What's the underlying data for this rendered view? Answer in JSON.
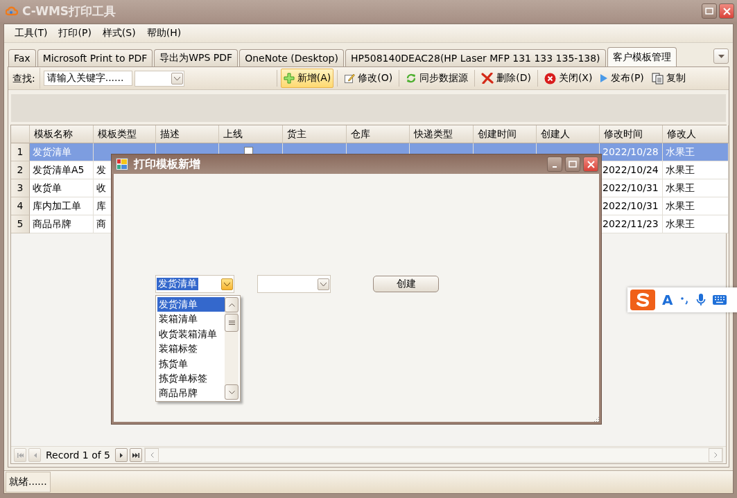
{
  "window": {
    "title": "C-WMS打印工具"
  },
  "menu": [
    "工具(T)",
    "打印(P)",
    "样式(S)",
    "帮助(H)"
  ],
  "tabs": [
    {
      "label": "Fax",
      "selected": false
    },
    {
      "label": "Microsoft Print to PDF",
      "selected": false
    },
    {
      "label": "导出为WPS PDF",
      "selected": false
    },
    {
      "label": "OneNote (Desktop)",
      "selected": false
    },
    {
      "label": "HP508140DEAC28(HP Laser MFP 131 133 135-138)",
      "selected": false
    },
    {
      "label": "客户模板管理",
      "selected": true
    }
  ],
  "toolbar": {
    "search_label": "查找:",
    "search_value": "请输入关键字......",
    "buttons": [
      {
        "kind": "add",
        "label": "新增(A)",
        "selected": true
      },
      {
        "kind": "edit",
        "label": "修改(O)",
        "selected": false
      },
      {
        "kind": "sync",
        "label": "同步数据源",
        "selected": false
      },
      {
        "kind": "delete",
        "label": "删除(D)",
        "selected": false
      },
      {
        "kind": "close",
        "label": "关闭(X)",
        "selected": false
      },
      {
        "kind": "publish",
        "label": "发布(P)",
        "selected": false
      },
      {
        "kind": "copy",
        "label": "复制",
        "selected": false
      }
    ]
  },
  "table": {
    "columns": [
      "模板名称",
      "模板类型",
      "描述",
      "上线",
      "货主",
      "仓库",
      "快递类型",
      "创建时间",
      "创建人",
      "修改时间",
      "修改人"
    ],
    "rows": [
      {
        "number": "1",
        "selected": true,
        "online": false,
        "cells": [
          "发货清单",
          null,
          null,
          null,
          null,
          null,
          null,
          null,
          null,
          "2022/10/28",
          "水果王"
        ]
      },
      {
        "number": "2",
        "selected": false,
        "cells": [
          "发货清单A5",
          "发",
          null,
          null,
          null,
          null,
          null,
          null,
          null,
          "2022/10/24",
          "水果王"
        ]
      },
      {
        "number": "3",
        "selected": false,
        "cells": [
          "收货单",
          "收",
          null,
          null,
          null,
          null,
          null,
          null,
          null,
          "2022/10/31",
          "水果王"
        ]
      },
      {
        "number": "4",
        "selected": false,
        "cells": [
          "库内加工单",
          "库",
          null,
          null,
          null,
          null,
          null,
          null,
          null,
          "2022/10/31",
          "水果王"
        ]
      },
      {
        "number": "5",
        "selected": false,
        "cells": [
          "商品吊牌",
          "商",
          null,
          null,
          null,
          null,
          null,
          null,
          null,
          "2022/11/23",
          "水果王"
        ]
      }
    ]
  },
  "navigator": {
    "text": "Record 1 of 5"
  },
  "status_bar": {
    "text": "就绪......"
  },
  "dialog": {
    "title": "打印模板新增",
    "combo_value": "发货清单",
    "button": "创建",
    "list": [
      {
        "label": "发货清单",
        "selected": true
      },
      {
        "label": "装箱清单",
        "selected": false
      },
      {
        "label": "收货装箱清单",
        "selected": false
      },
      {
        "label": "装箱标签",
        "selected": false
      },
      {
        "label": "拣货单",
        "selected": false
      },
      {
        "label": "拣货单标签",
        "selected": false
      },
      {
        "label": "商品吊牌",
        "selected": false
      }
    ]
  },
  "ime_bar": {
    "mode": "A"
  }
}
